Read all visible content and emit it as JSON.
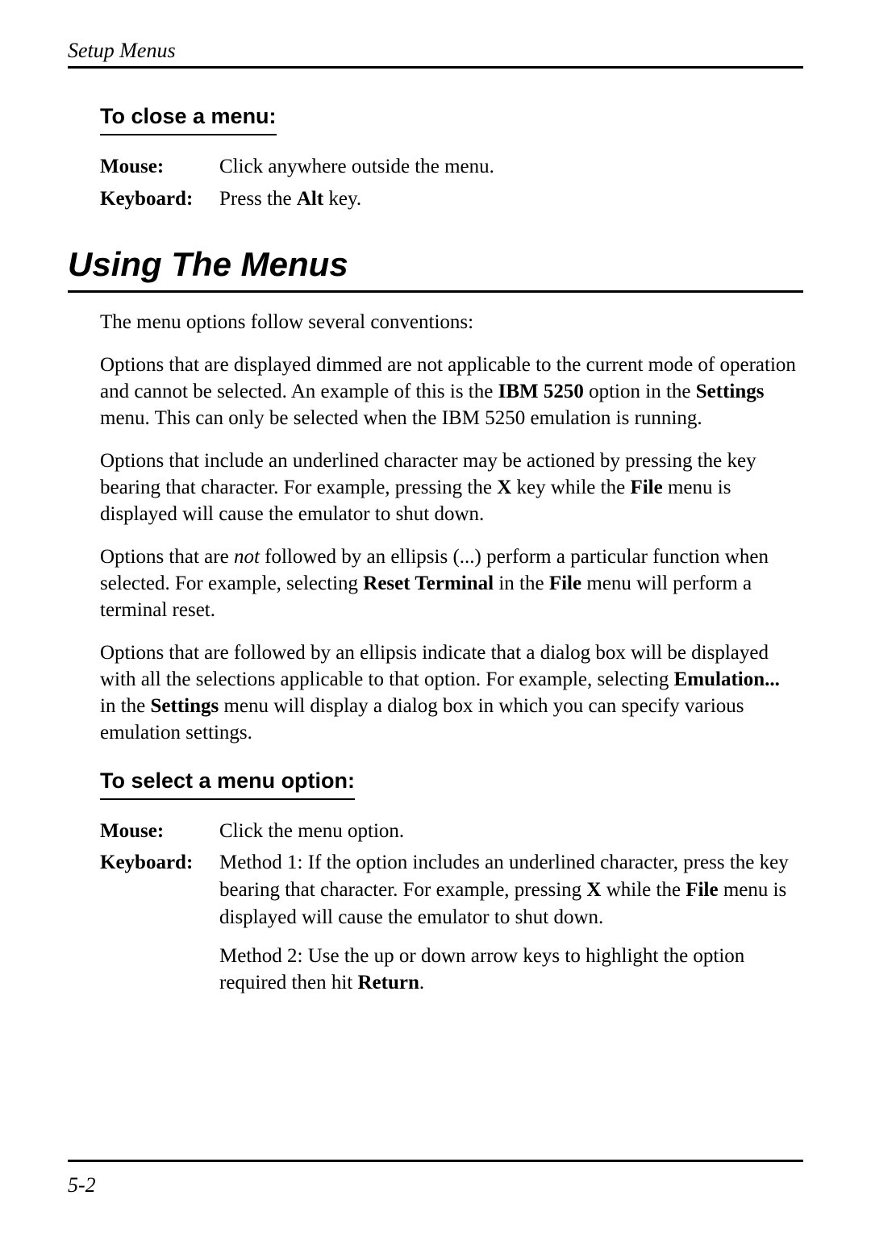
{
  "header": {
    "running_title": "Setup Menus"
  },
  "section1": {
    "title": "To close a menu:",
    "rows": {
      "mouse_label": "Mouse:",
      "mouse_body": "Click anywhere outside the menu.",
      "keyboard_label": "Keyboard:",
      "keyboard_pre": "Press the ",
      "keyboard_bold": "Alt",
      "keyboard_post": " key."
    }
  },
  "main_heading": "Using The Menus",
  "body": {
    "p1": "The menu options follow several conventions:",
    "p2a": "Options that are displayed dimmed are not applicable to the current mode of operation and cannot be selected. An example of this is the ",
    "p2b": "IBM 5250",
    "p2c": " option in the ",
    "p2d": "Settings",
    "p2e": " menu. This can only be selected when the IBM 5250 emulation is running.",
    "p3a": "Options that include an underlined character may be actioned by pressing the key bearing that character. For example, pressing the ",
    "p3b": "X",
    "p3c": " key while the ",
    "p3d": "File",
    "p3e": " menu is displayed will cause the emulator to shut down.",
    "p4a": "Options that are ",
    "p4b": "not",
    "p4c": " followed by an ellipsis (...) perform a particular function when selected. For example, selecting ",
    "p4d": "Reset Terminal",
    "p4e": " in the ",
    "p4f": "File",
    "p4g": " menu will perform a terminal reset.",
    "p5a": "Options that are followed by an ellipsis indicate that a dialog box will be displayed with all the selections applicable to that option. For example, selecting ",
    "p5b": "Emulation...",
    "p5c": " in the ",
    "p5d": "Settings",
    "p5e": " menu will display a dialog box in which you can specify various emulation settings."
  },
  "section2": {
    "title": "To select a menu option:",
    "mouse_label": "Mouse:",
    "mouse_body": "Click the menu option.",
    "keyboard_label": "Keyboard:",
    "m1a": "Method 1:  If the option includes an underlined character, press the key bearing that character. For example, pressing ",
    "m1b": "X",
    "m1c": " while the ",
    "m1d": "File",
    "m1e": " menu is displayed will cause the emulator to shut down.",
    "m2a": "Method 2:  Use the up or down arrow keys to highlight the option required then hit ",
    "m2b": "Return",
    "m2c": "."
  },
  "footer": {
    "page_number": "5-2"
  }
}
